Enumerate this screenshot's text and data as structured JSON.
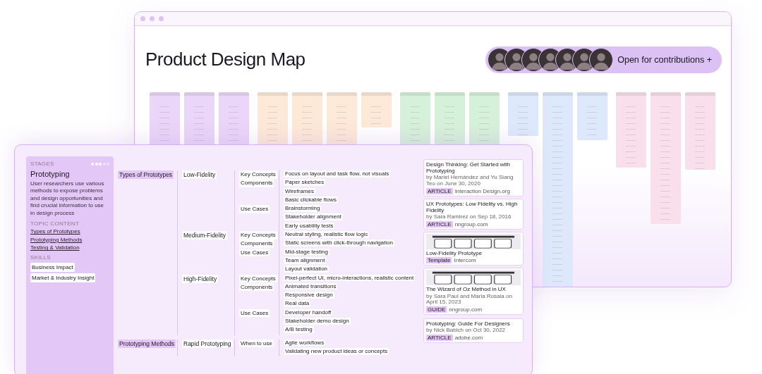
{
  "window": {
    "title": "Product Design Map"
  },
  "contributors": {
    "label": "Open for contributions +"
  },
  "map_columns": [
    {
      "color": "#ead6f8"
    },
    {
      "color": "#ead6f8"
    },
    {
      "color": "#ead6f8"
    },
    {
      "color": "#fde9d8"
    },
    {
      "color": "#fde9d8"
    },
    {
      "color": "#fde9d8"
    },
    {
      "color": "#fde9d8"
    },
    {
      "color": "#d6f1da"
    },
    {
      "color": "#d6f1da"
    },
    {
      "color": "#d6f1da"
    },
    {
      "color": "#dde9fb"
    },
    {
      "color": "#dde9fb"
    },
    {
      "color": "#dde9fb"
    },
    {
      "color": "#f9dfec"
    },
    {
      "color": "#f9dfec"
    },
    {
      "color": "#f9dfec"
    }
  ],
  "topic_card": {
    "eyebrow": "STAGES",
    "dots": [
      {
        "filled": true
      },
      {
        "filled": true
      },
      {
        "filled": true
      },
      {
        "filled": false
      },
      {
        "filled": false
      }
    ],
    "title": "Prototyping",
    "description": "User researchers use various methods to expose problems and design opportunities and find crucial information to use in design process",
    "content_label": "TOPIC CONTENT",
    "links": [
      "Types of Prototypes",
      "Prototyping Methods",
      "Testing & Validation"
    ],
    "skills_label": "SKILLS",
    "skills": [
      "Business Impact",
      "Market & Industry Insight"
    ]
  },
  "tree": [
    {
      "label": "Types of Prototypes",
      "children": [
        {
          "label": "Low-Fidelity",
          "children": [
            {
              "label": "Key Concepts",
              "children": [
                {
                  "label": "Focus on layout and task flow, not visuals"
                }
              ]
            },
            {
              "label": "Components",
              "children": [
                {
                  "label": "Paper sketches"
                },
                {
                  "label": "Wireframes"
                },
                {
                  "label": "Basic clickable flows"
                }
              ]
            },
            {
              "label": "Use Cases",
              "children": [
                {
                  "label": "Brainstorming"
                },
                {
                  "label": "Stakeholder alignment"
                },
                {
                  "label": "Early usability tests"
                }
              ]
            }
          ]
        },
        {
          "label": "Medium-Fidelity",
          "children": [
            {
              "label": "Key Concepts",
              "children": [
                {
                  "label": "Neutral styling, realistic flow logic"
                }
              ]
            },
            {
              "label": "Components",
              "children": [
                {
                  "label": "Static screens with click-through navigation"
                }
              ]
            },
            {
              "label": "Use Cases",
              "children": [
                {
                  "label": "Mid-stage testing"
                },
                {
                  "label": "Team alignment"
                },
                {
                  "label": "Layout validation"
                }
              ]
            }
          ]
        },
        {
          "label": "High-Fidelity",
          "children": [
            {
              "label": "Key Concepts",
              "children": [
                {
                  "label": "Pixel-perfect UI, micro-interactions, realistic content"
                }
              ]
            },
            {
              "label": "Components",
              "children": [
                {
                  "label": "Animated transitions"
                },
                {
                  "label": "Responsive design"
                },
                {
                  "label": "Real data"
                }
              ]
            },
            {
              "label": "Use Cases",
              "children": [
                {
                  "label": "Developer handoff"
                },
                {
                  "label": "Stakeholder demo design"
                },
                {
                  "label": "A/B testing"
                }
              ]
            }
          ]
        }
      ]
    },
    {
      "label": "Prototyping Methods",
      "children": [
        {
          "label": "Rapid Prototyping",
          "children": [
            {
              "label": "When to use",
              "children": [
                {
                  "label": "Agile workflows"
                },
                {
                  "label": "Validating new product ideas or concepts"
                }
              ]
            }
          ]
        }
      ]
    }
  ],
  "resources": [
    {
      "kind": "link",
      "title": "Design Thinking: Get Started with Prototyping",
      "byline": "by Mariel Hernández and Yu Siang Teo on June 30, 2020",
      "tag": "ARTICLE",
      "source": "Interaction Design.org"
    },
    {
      "kind": "link",
      "title": "UX Prototypes: Low Fidelity vs. High Fidelity",
      "byline": "by Sara Ramirez on Sep 18, 2016",
      "tag": "ARTICLE",
      "source": "nngroup.com"
    },
    {
      "kind": "image",
      "title": "Low-Fidelity Prototype",
      "tag": "Template",
      "source": "Intercom"
    },
    {
      "kind": "image",
      "title": "The Wizard of Oz Method in UX",
      "byline": "by Sara Paul and Maria Rosala on April 15, 2023",
      "tag": "GUIDE",
      "source": "nngroup.com"
    },
    {
      "kind": "link",
      "title": "Prototyping: Guide For Designers",
      "byline": "by Nick Babich on Oct 30, 2022",
      "tag": "ARTICLE",
      "source": "adobe.com"
    }
  ]
}
